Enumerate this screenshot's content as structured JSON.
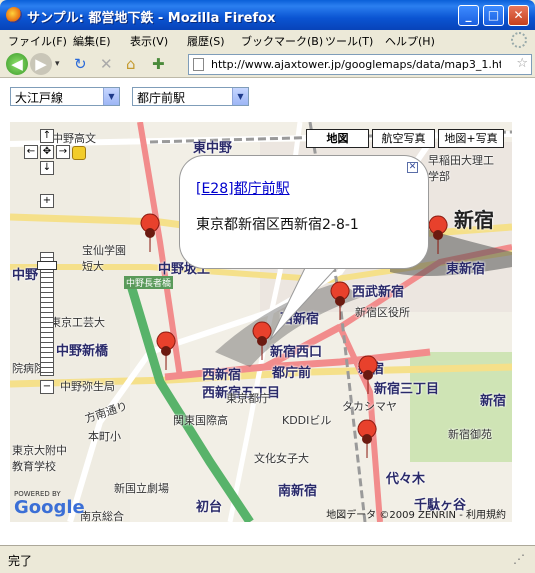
{
  "window": {
    "title": "サンプル: 都営地下鉄 - Mozilla Firefox"
  },
  "menu": [
    "ファイル(F)",
    "編集(E)",
    "表示(V)",
    "履歴(S)",
    "ブックマーク(B)",
    "ツール(T)",
    "ヘルプ(H)"
  ],
  "address": {
    "url": "http://www.ajaxtower.jp/googlemaps/data/map3_1.ht"
  },
  "selects": {
    "line": "大江戸線",
    "station": "都庁前駅"
  },
  "map_types": {
    "map": "地図",
    "satellite": "航空写真",
    "hybrid": "地図+写真"
  },
  "info_window": {
    "link": "[E28]都庁前駅",
    "address": "東京都新宿区西新宿2-8-1"
  },
  "map_labels": {
    "nakano_takada": "中野高文",
    "higashinakano": "東中野",
    "waseda": "早稲田大理工学部",
    "shinjuku_big": "新宿",
    "hosen": "宝仙学園短大",
    "nakano_sakaue": "中野坂上",
    "nakano_chojakyo": "中野長者橋",
    "nakano": "中野",
    "tokyo_kogei": "東京工芸大",
    "nakano_shinbashi": "中野新橋",
    "nishi_shinjuku_big": "西新宿",
    "tocho": "東京都庁",
    "nishi_shinjuku_go": "西新宿五丁目",
    "tochomae": "都庁前",
    "nishi_shinjuku": "西新宿",
    "seibu_shinjuku": "西武新宿",
    "shinjuku_kuyakusho": "新宿区役所",
    "higashi_shinjuku": "東新宿",
    "shinjuku_nishiguchi": "新宿西口",
    "shinjuku": "新宿",
    "shinjuku_sanchome": "新宿三丁目",
    "takashimaya": "タカシマヤ",
    "shinjuku_gyoen": "新宿御苑",
    "kddi": "KDDIビル",
    "nakano_yayoi": "中野弥生局",
    "hoken": "方南通り",
    "kokusai": "関東国際高",
    "honcho": "本町小",
    "tokyodai": "東京大附中教育学校",
    "bunka": "文化女子大",
    "shinkoku": "新国立劇場",
    "hatsudai": "初台",
    "minami_shinjuku": "南新宿",
    "yoyogi": "代々木",
    "sendagaya": "千駄ヶ谷",
    "minami_ryokoku": "南京総合",
    "shinjuku_east": "新宿",
    "byoin": "院病院"
  },
  "branding": {
    "powered": "POWERED BY",
    "logo": "Google",
    "copyright": "地図データ ©2009 ZENRIN - 利用規約"
  },
  "status": {
    "text": "完了"
  }
}
